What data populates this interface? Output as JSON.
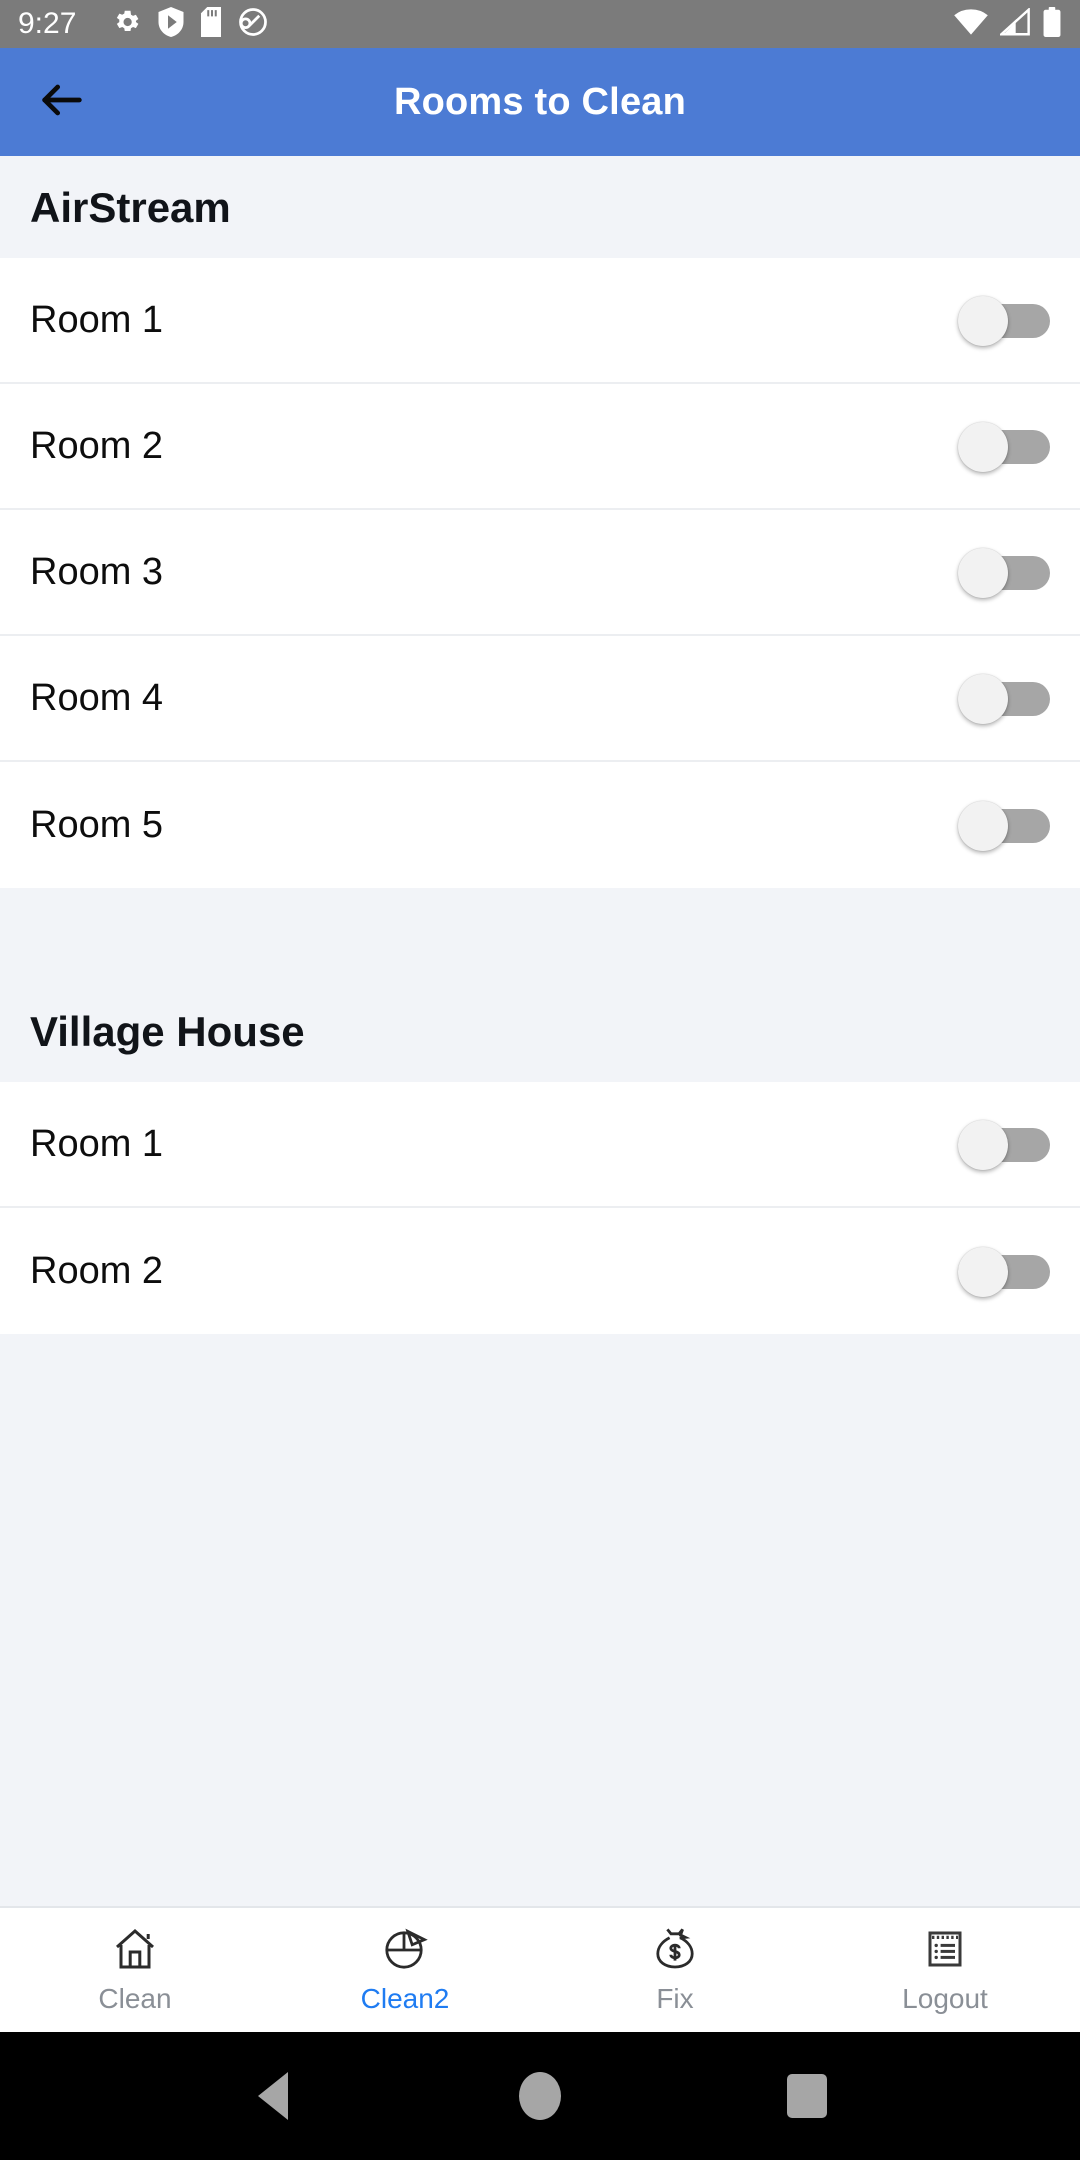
{
  "statusbar": {
    "time": "9:27",
    "left_icons": [
      "gear-icon",
      "play-shield-icon",
      "sd-card-icon",
      "circle-swirl-icon"
    ],
    "right_icons": [
      "wifi-icon",
      "cellular-signal-icon",
      "battery-icon"
    ],
    "background_color": "#7b7b7b"
  },
  "appbar": {
    "title": "Rooms to Clean",
    "back_icon": "back-arrow-icon",
    "background_color": "#4c7bd4",
    "title_color": "#ffffff"
  },
  "sections": [
    {
      "title": "AirStream",
      "rooms": [
        {
          "label": "Room 1",
          "toggle_on": false
        },
        {
          "label": "Room 2",
          "toggle_on": false
        },
        {
          "label": "Room 3",
          "toggle_on": false
        },
        {
          "label": "Room 4",
          "toggle_on": false
        },
        {
          "label": "Room 5",
          "toggle_on": false
        }
      ]
    },
    {
      "title": "Village House",
      "rooms": [
        {
          "label": "Room 1",
          "toggle_on": false
        },
        {
          "label": "Room 2",
          "toggle_on": false
        }
      ]
    }
  ],
  "bottom_nav": {
    "active_index": 1,
    "active_color": "#1f7cf2",
    "inactive_color": "#8a8f96",
    "items": [
      {
        "label": "Clean",
        "icon": "house-icon"
      },
      {
        "label": "Clean2",
        "icon": "pie-chart-icon"
      },
      {
        "label": "Fix",
        "icon": "money-bag-icon"
      },
      {
        "label": "Logout",
        "icon": "receipt-list-icon"
      }
    ]
  },
  "android_nav": {
    "buttons": [
      "back-triangle-icon",
      "home-circle-icon",
      "recents-square-icon"
    ],
    "background_color": "#000000"
  }
}
